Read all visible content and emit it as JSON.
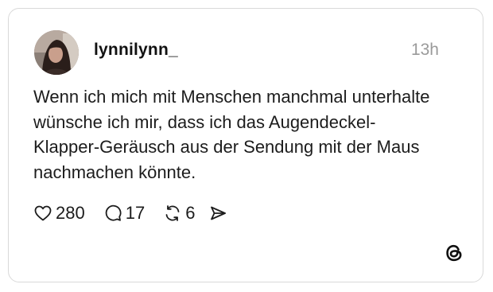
{
  "post": {
    "username": "lynnilynn_",
    "timestamp": "13h",
    "text": "Wenn ich mich mit Menschen manchmal unterhalte\nwünsche ich mir, dass ich das Augendeckel-\nKlapper-Geräusch aus der Sendung mit der Maus\nnachmachen könnte.",
    "avatar_icon": "user-avatar-photo"
  },
  "actions": {
    "like": {
      "icon": "heart-icon",
      "count": "280"
    },
    "reply": {
      "icon": "comment-icon",
      "count": "17"
    },
    "repost": {
      "icon": "repost-icon",
      "count": "6"
    },
    "share": {
      "icon": "send-icon"
    }
  },
  "branding": {
    "logo": "threads-logo-icon"
  },
  "colors": {
    "border": "#d9d9d9",
    "text": "#1c1c1c",
    "muted": "#9a9a9a"
  }
}
